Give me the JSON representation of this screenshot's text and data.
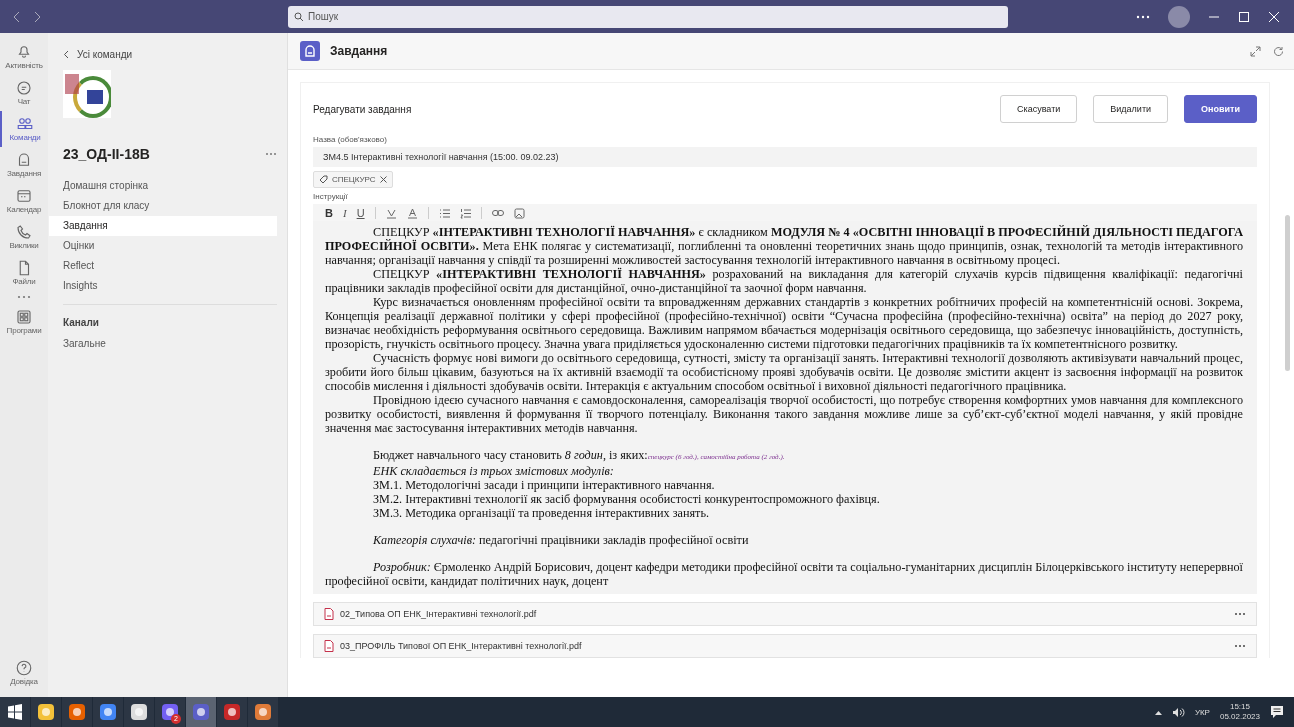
{
  "titlebar": {
    "search": {
      "placeholder": "Пошук"
    }
  },
  "rail": {
    "items": [
      {
        "label": "Активність",
        "selected": false
      },
      {
        "label": "Чат",
        "selected": false
      },
      {
        "label": "Команди",
        "selected": true
      },
      {
        "label": "Завдання",
        "selected": false
      },
      {
        "label": "Календар",
        "selected": false
      },
      {
        "label": "Виклики",
        "selected": false
      },
      {
        "label": "Файли",
        "selected": false
      }
    ],
    "apps_label": "Програми",
    "help_label": "Довідка"
  },
  "team": {
    "back": "Усі команди",
    "name": "23_ОД-II-18В",
    "nav": [
      {
        "label": "Домашня сторінка",
        "selected": false
      },
      {
        "label": "Блокнот для класу",
        "selected": false
      },
      {
        "label": "Завдання",
        "selected": true
      },
      {
        "label": "Оцінки",
        "selected": false
      },
      {
        "label": "Reflect",
        "selected": false
      },
      {
        "label": "Insights",
        "selected": false
      }
    ],
    "channels_heading": "Канали",
    "channels": [
      {
        "label": "Загальне",
        "selected": false
      }
    ]
  },
  "main": {
    "title": "Завдання"
  },
  "form": {
    "heading": "Редагувати завдання",
    "buttons": [
      {
        "label": "Скасувати",
        "kind": "secondary"
      },
      {
        "label": "Видалити",
        "kind": "secondary"
      },
      {
        "label": "Оновити",
        "kind": "primary"
      }
    ],
    "title_label": "Назва (обов'язково)",
    "title_value": "ЗМ4.5 Інтерактивні технології навчання (15:00. 09.02.23)",
    "tags": [
      "СПЕЦКУРС"
    ],
    "instructions_label": "Інструкції",
    "toolbar": [
      "B",
      "I",
      "U"
    ],
    "paragraphs": [
      "СПЕЦКУР **«ІНТЕРАКТИВНІ ТЕХНОЛОГІЇ НАВЧАННЯ»** є складником **МОДУЛЯ № 4 «ОСВІТНІ ІННОВАЦІЇ В ПРОФЕСІЙНІЙ ДІЯЛЬНОСТІ ПЕДАГОГА ПРОФЕСІЙНОЇ ОСВІТИ».** Мета ЕНК полягає у систематизації, поглибленні та оновленні теоретичних знань щодо принципів, ознак, технологій та методів інтерактивного навчання; організації навчання у співдії та розширенні можливостей застосування технологій інтерактивного навчання в освітньому процесі.",
      "СПЕЦКУР **«ІНТЕРАКТИВНІ ТЕХНОЛОГІЇ НАВЧАННЯ»** розрахований на викладання для категорій слухачів курсів підвищення кваліфікації: педагогічні працівники закладів професійної освіти для дистанційної, очно-дистанційної та заочної форм навчання.",
      "Курс визначається оновленням професійної освіти та впровадженням державних стандартів з конкретних робітничих професій на компетентнісній основі. Зокрема, Концепція реалізації державної політики у сфері професійної (професійно-технічної) освіти “Сучасна професійна (професійно-технічна) освіта” на період до 2027 року, визначає необхідність реформування освітнього середовища. Важливим напрямом вбачається модернізація освітнього середовища, що забезпечує інноваційність, доступність, прозорість, гнучкість освітнього процесу. Значна увага приділяється удосконаленню системи підготовки педагогічних працівників та їх компетентнісного розвитку.",
      "Сучасність формує нові вимоги до освітнього середовища, сутності, змісту та організації занять. Інтерактивні технології дозволяють активізувати навчальний процес, зробити його більш цікавим, базуються на їх активній взаємодії та особистісному прояві здобувачів освіти. Це дозволяє змістити акцент із засвоєння інформації на розвиток способів мислення і діяльності здобувачів освіти. Інтеракція є актуальним способом освітньої і виховної діяльності педагогічного працівника.",
      "Провідною ідеєю сучасного навчання є самовдосконалення, самореалізація творчої особистості, що потребує створення комфортних умов навчання для комплексного розвитку особистості, виявлення й формування її творчого потенціалу. Виконання такого завдання можливе лише за суб’єкт-суб’єктної моделі навчання, у якій провідне значення має застосування інтерактивних методів навчання."
    ],
    "budget": {
      "text": "Бюджет навчального часу становить *8 годин*, із яких:",
      "note": "спецкурс (6 год.), самостійна робота (2 год.)."
    },
    "modules_intro": "ЕНК складається із трьох змістових модулів:",
    "modules": [
      "ЗМ.1. Методологічні засади і принципи інтерактивного навчання.",
      "ЗМ.2. Інтерактивні технології як засіб формування особистості конкурентоспроможного фахівця.",
      "ЗМ.3. Методика організації та проведення інтерактивних занять."
    ],
    "category": "*Категорія слухачів:* педагогічні працівники закладів професійної освіти",
    "author": "*Розробник:* Єрмоленко Андрій Борисович, доцент кафедри методики професійної освіти та соціально-гуманітарних дисциплін Білоцерківського інституту неперервної професійної освіти, кандидат політичних наук, доцент",
    "attachments": [
      "02_Типова ОП ЕНК_Інтерактивні технології.pdf",
      "03_ПРОФІЛЬ Типової ОП ЕНК_Інтерактивні технології.pdf"
    ]
  },
  "taskbar": {
    "apps": [
      {
        "selected": false
      },
      {
        "selected": false
      },
      {
        "selected": false
      },
      {
        "selected": false
      },
      {
        "selected": false
      },
      {
        "selected": false,
        "badge": "2"
      },
      {
        "selected": true
      },
      {
        "selected": false
      },
      {
        "selected": false
      }
    ],
    "tray": {
      "language": "УКР",
      "time": "15:15",
      "date": "05.02.2023"
    }
  }
}
